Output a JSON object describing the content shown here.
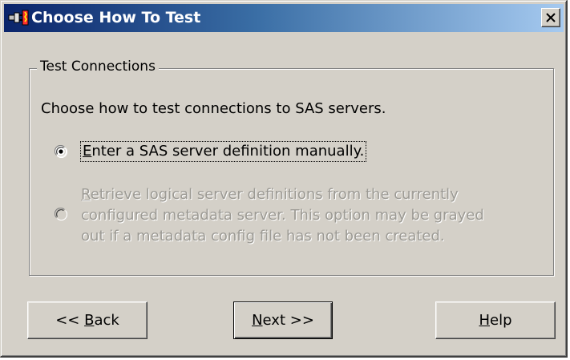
{
  "window": {
    "title": "Choose How To Test",
    "close_glyph": "✕",
    "title_icon": "plug-icon"
  },
  "group": {
    "legend": "Test Connections",
    "instruction": "Choose how to test connections to SAS servers."
  },
  "options": [
    {
      "mnemonic": "E",
      "rest": "nter a SAS server definition manually.",
      "selected": true,
      "enabled": true
    },
    {
      "mnemonic": "R",
      "line1_rest": "etrieve logical server definitions from the currently",
      "line2": "configured metadata server.  This option may be grayed",
      "line3": "out if a metadata config file has not been created.",
      "selected": false,
      "enabled": false
    }
  ],
  "buttons": {
    "back": {
      "prefix": "<< ",
      "mnemonic": "B",
      "rest": "ack"
    },
    "next": {
      "mnemonic": "N",
      "rest": "ext >>"
    },
    "help": {
      "mnemonic": "H",
      "rest": "elp"
    }
  },
  "colors": {
    "face": "#d4d0c8",
    "title_gradient_start": "#0a246a",
    "title_gradient_end": "#a6caf0",
    "disabled_text": "#9c9a94"
  }
}
